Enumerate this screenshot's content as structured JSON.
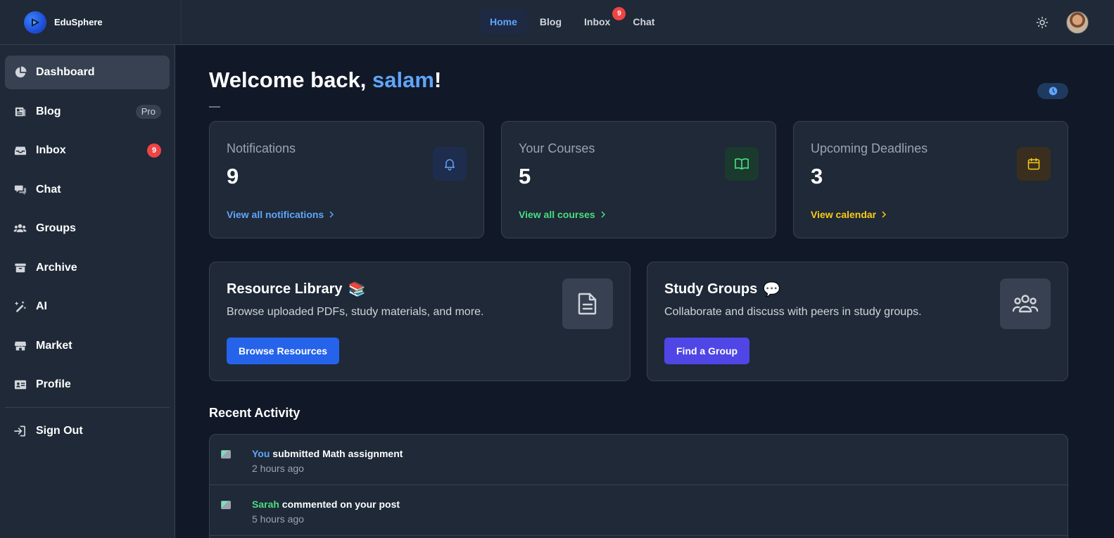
{
  "brand": {
    "name": "EduSphere"
  },
  "topnav": {
    "items": [
      {
        "label": "Home",
        "active": true
      },
      {
        "label": "Blog"
      },
      {
        "label": "Inbox",
        "badge": "9"
      },
      {
        "label": "Chat"
      }
    ]
  },
  "sidebar": {
    "items": [
      {
        "label": "Dashboard",
        "icon": "pie-chart-icon",
        "active": true
      },
      {
        "label": "Blog",
        "icon": "newspaper-icon",
        "pill": "Pro"
      },
      {
        "label": "Inbox",
        "icon": "inbox-icon",
        "badge": "9"
      },
      {
        "label": "Chat",
        "icon": "chat-icon"
      },
      {
        "label": "Groups",
        "icon": "users-icon"
      },
      {
        "label": "Archive",
        "icon": "archive-icon"
      },
      {
        "label": "AI",
        "icon": "magic-wand-icon"
      },
      {
        "label": "Market",
        "icon": "store-icon"
      },
      {
        "label": "Profile",
        "icon": "id-card-icon"
      }
    ],
    "signout": "Sign Out"
  },
  "welcome": {
    "prefix": "Welcome back, ",
    "username": "salam",
    "suffix": "!"
  },
  "stats": [
    {
      "title": "Notifications",
      "value": "9",
      "link": "View all notifications",
      "color": "#60a5fa",
      "icon": "bell-icon"
    },
    {
      "title": "Your Courses",
      "value": "5",
      "link": "View all courses",
      "color": "#4ade80",
      "icon": "book-open-icon"
    },
    {
      "title": "Upcoming Deadlines",
      "value": "3",
      "link": "View calendar",
      "color": "#facc15",
      "icon": "calendar-icon"
    }
  ],
  "features": [
    {
      "title": "Resource Library",
      "emoji": "📚",
      "desc": "Browse uploaded PDFs, study materials, and more.",
      "button": "Browse Resources",
      "button_color": "#2563eb",
      "icon": "document-icon"
    },
    {
      "title": "Study Groups",
      "emoji": "💬",
      "desc": "Collaborate and discuss with peers in study groups.",
      "button": "Find a Group",
      "button_color": "#4f46e5",
      "icon": "group-icon"
    }
  ],
  "recent": {
    "title": "Recent Activity",
    "items": [
      {
        "actor": "You",
        "actor_color": "#60a5fa",
        "action": " submitted Math assignment",
        "time": "2 hours ago"
      },
      {
        "actor": "Sarah",
        "actor_color": "#4ade80",
        "action": " commented on your post",
        "time": "5 hours ago"
      }
    ]
  }
}
